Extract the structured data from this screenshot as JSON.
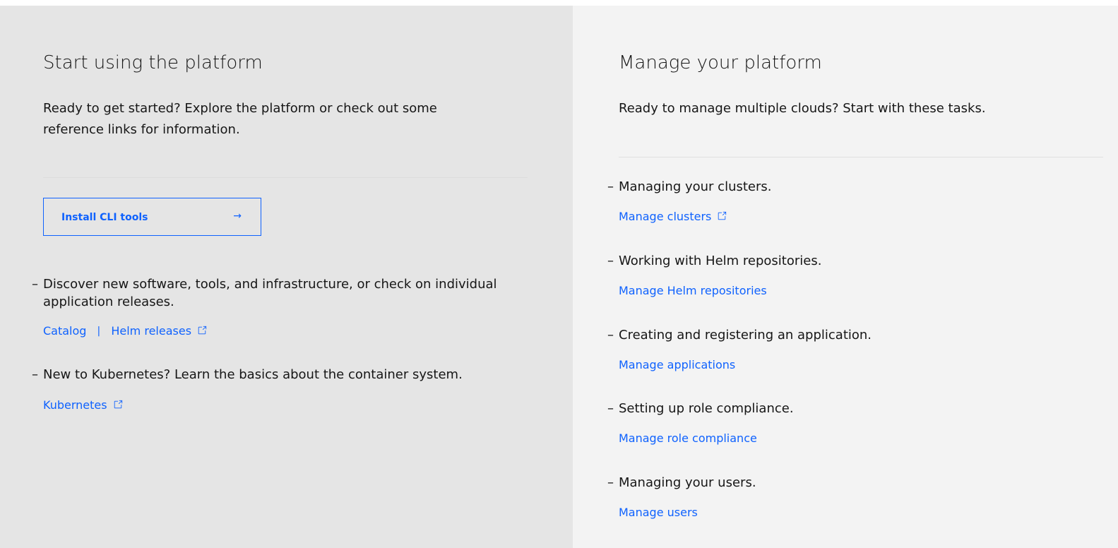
{
  "left": {
    "title": "Start using the platform",
    "description": "Ready to get started? Explore the platform or check out some reference links for information.",
    "install_button": {
      "label": "Install CLI tools",
      "icon": "arrow-right-icon"
    },
    "tasks": [
      {
        "text": "Discover new software, tools, and infrastructure, or check on individual application releases.",
        "links": [
          {
            "label": "Catalog"
          },
          {
            "label": "Helm releases",
            "icon": "external-link-icon"
          }
        ]
      },
      {
        "text": "New to Kubernetes? Learn the basics about the container system.",
        "links": [
          {
            "label": "Kubernetes",
            "icon": "external-link-icon"
          }
        ]
      }
    ]
  },
  "right": {
    "title": "Manage your platform",
    "description": "Ready to manage multiple clouds? Start with these tasks.",
    "tasks": [
      {
        "text": "Managing your clusters.",
        "link": {
          "label": "Manage clusters",
          "icon": "external-link-icon"
        }
      },
      {
        "text": "Working with Helm repositories.",
        "link": {
          "label": "Manage Helm repositories"
        }
      },
      {
        "text": "Creating and registering an application.",
        "link": {
          "label": "Manage applications"
        }
      },
      {
        "text": "Setting up role compliance.",
        "link": {
          "label": "Manage role compliance"
        }
      },
      {
        "text": "Managing your users.",
        "link": {
          "label": "Manage users"
        }
      }
    ]
  },
  "bullet": "–",
  "link_separator": "|",
  "colors": {
    "left_bg": "#e5e5e5",
    "right_bg": "#f3f3f3",
    "link": "#0f62fe",
    "text": "#161616"
  }
}
